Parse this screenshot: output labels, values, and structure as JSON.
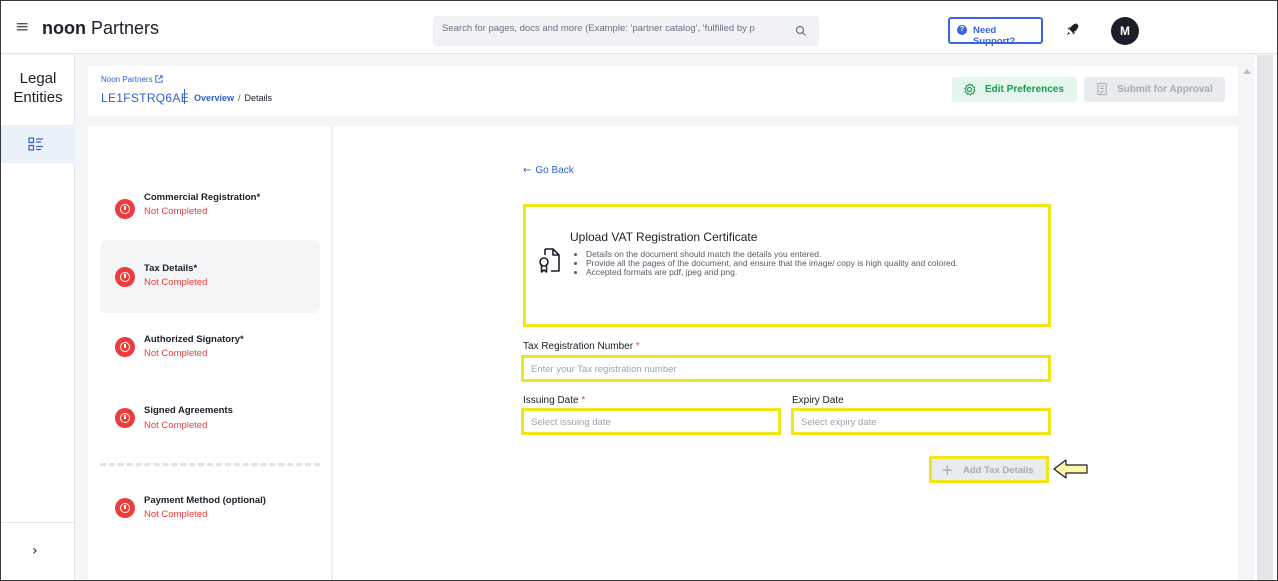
{
  "topbar": {
    "brand_bold": "noon",
    "brand_rest": " Partners",
    "search_placeholder": "Search for pages, docs and more (Example: 'partner catalog', 'fulfilled by p",
    "support_label": "Need Support?",
    "avatar_initial": "M"
  },
  "rail": {
    "title": "Legal Entities"
  },
  "header": {
    "parent_link": "Noon Partners",
    "entity_id": "LE1FSTRQ6AE",
    "crumb_overview": "Overview",
    "crumb_separator": "/",
    "crumb_current": "Details",
    "edit_label": "Edit Preferences",
    "submit_label": "Submit for Approval"
  },
  "steps": [
    {
      "title": "Commercial Registration*",
      "status": "Not Completed"
    },
    {
      "title": "Tax Details*",
      "status": "Not Completed"
    },
    {
      "title": "Authorized Signatory*",
      "status": "Not Completed"
    },
    {
      "title": "Signed Agreements",
      "status": "Not Completed"
    },
    {
      "title": "Payment Method (optional)",
      "status": "Not Completed"
    }
  ],
  "form": {
    "go_back": "Go Back",
    "upload_title": "Upload VAT Registration Certificate",
    "upload_notes": [
      "Details on the document should match the details you entered.",
      "Provide all the pages of the document, and ensure that the image/ copy is high quality and colored.",
      "Accepted formats are pdf, jpeg and png."
    ],
    "trn_label": "Tax Registration Number",
    "trn_placeholder": "Enter your Tax registration number",
    "issuing_label": "Issuing Date",
    "issuing_placeholder": "Select issuing date",
    "expiry_label": "Expiry Date",
    "expiry_placeholder": "Select expiry date",
    "required_mark": "*",
    "add_label": "Add Tax Details"
  },
  "colors": {
    "accent_blue": "#2e5fd6",
    "error_red": "#ee3b3b",
    "success_green": "#1a9c4e",
    "highlight_yellow": "#f1e51c"
  }
}
